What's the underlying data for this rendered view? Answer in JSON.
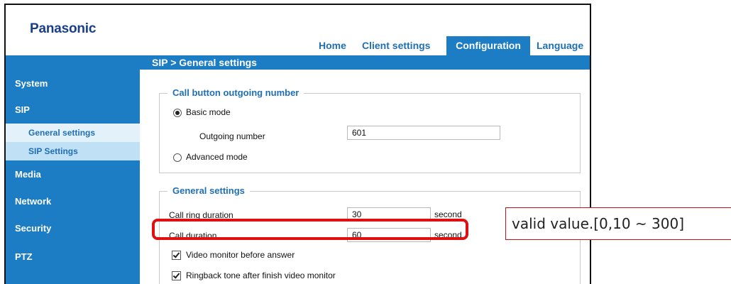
{
  "brand": {
    "logo": "Panasonic"
  },
  "top_nav": {
    "items": [
      "Home",
      "Client settings",
      "Configuration",
      "Language"
    ],
    "active": "Configuration"
  },
  "page_title": "SIP  > General settings",
  "sidebar": {
    "items": [
      "System",
      "SIP",
      "Media",
      "Network",
      "Security",
      "PTZ"
    ],
    "sip_subitems": [
      "General settings",
      "SIP Settings"
    ],
    "selected_subitem": "SIP Settings"
  },
  "call_button_group": {
    "legend": "Call button outgoing number",
    "basic_mode_label": "Basic mode",
    "basic_mode_checked": true,
    "outgoing_number_label": "Outgoing number",
    "outgoing_number_value": "601",
    "advanced_mode_label": "Advanced mode",
    "advanced_mode_checked": false
  },
  "general_group": {
    "legend": "General settings",
    "ring_duration_label": "Call ring duration",
    "ring_duration_value": "30",
    "ring_duration_unit": "second",
    "call_duration_label": "Call duration",
    "call_duration_value": "60",
    "call_duration_unit": "second",
    "video_monitor_label": "Video monitor before answer",
    "video_monitor_checked": true,
    "ringback_label": "Ringback tone after finish video monitor",
    "ringback_checked": true
  },
  "annotation": {
    "note": "valid value.[0,10 ~ 300]",
    "highlight_color": "#e01010"
  },
  "colors": {
    "accent": "#1c7cc4",
    "link": "#1f6fb7",
    "logo": "#1b3e8c"
  }
}
